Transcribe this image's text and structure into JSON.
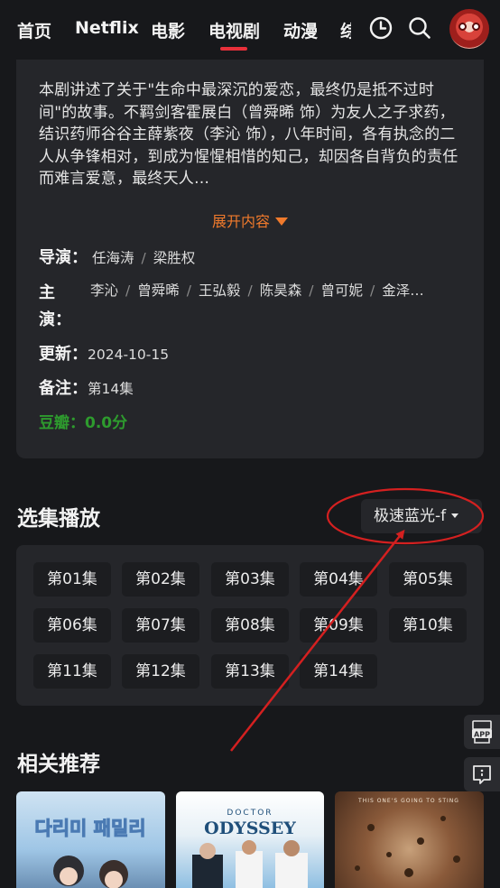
{
  "nav": {
    "items": [
      "首页",
      "Netflix",
      "电影",
      "电视剧",
      "动漫",
      "综"
    ],
    "active_index": 3
  },
  "info": {
    "description": "本剧讲述了关于\"生命中最深沉的爱恋，最终仍是抵不过时间\"的故事。不羁剑客霍展白（曾舜晞 饰）为友人之子求药，结识药师谷谷主薛紫夜（李沁 饰），八年时间，各有执念的二人从争锋相对，到成为惺惺相惜的知己，却因各自背负的责任而难言爱意，最终天人…",
    "expand_label": "展开内容",
    "director_label": "导演：",
    "directors": [
      "任海涛",
      "梁胜权"
    ],
    "cast_label": "主演：",
    "cast": [
      "李沁",
      "曾舜晞",
      "王弘毅",
      "陈昊森",
      "曾可妮",
      "金泽…"
    ],
    "updated_label": "更新：",
    "updated": "2024-10-15",
    "note_label": "备注：",
    "note": "第14集",
    "douban_label": "豆瓣：",
    "douban_score": "0.0分"
  },
  "episodes": {
    "title": "选集播放",
    "source": "极速蓝光-f",
    "items": [
      "第01集",
      "第02集",
      "第03集",
      "第04集",
      "第05集",
      "第06集",
      "第07集",
      "第08集",
      "第09集",
      "第10集",
      "第11集",
      "第12集",
      "第13集",
      "第14集"
    ]
  },
  "side": {
    "app_label": "APP"
  },
  "recommend": {
    "title": "相关推荐",
    "posters": [
      {
        "text": "다리미 패밀리",
        "accent": "#bcd7ee"
      },
      {
        "text": "DOCTOR ODYSSEY",
        "accent": "#7fb6df"
      },
      {
        "text": "THIS ONE'S GOING TO STING",
        "accent": "#8a5a3a"
      }
    ]
  },
  "colors": {
    "background": "#17181b",
    "card": "#25262a",
    "accent_orange": "#f07a2c",
    "accent_red": "#e8303a",
    "douban_green": "#2e9b2e",
    "annotation_red": "#d42020"
  }
}
